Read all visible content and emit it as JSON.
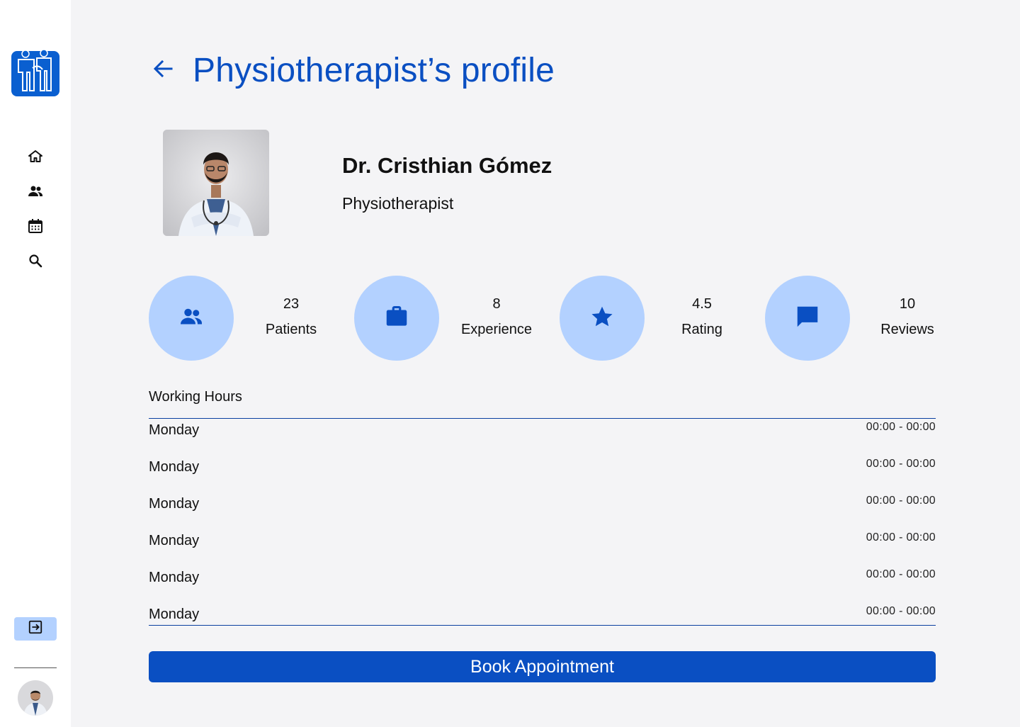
{
  "header": {
    "title": "Physiotherapist’s profile"
  },
  "sidebar": {
    "logo_icon": "family-care-logo",
    "nav": [
      {
        "icon": "home-icon"
      },
      {
        "icon": "people-icon"
      },
      {
        "icon": "calendar-icon"
      },
      {
        "icon": "search-icon"
      }
    ],
    "logout_icon": "logout-icon"
  },
  "doctor": {
    "name": "Dr. Cristhian Gómez",
    "role": "Physiotherapist"
  },
  "stats": [
    {
      "value": "23",
      "label": "Patients",
      "icon": "people-icon"
    },
    {
      "value": "8",
      "label": "Experience",
      "icon": "briefcase-icon"
    },
    {
      "value": "4.5",
      "label": "Rating",
      "icon": "star-icon"
    },
    {
      "value": "10",
      "label": "Reviews",
      "icon": "chat-icon"
    }
  ],
  "working_hours": {
    "title": "Working Hours",
    "rows": [
      {
        "day": "Monday",
        "time": "00:00 - 00:00"
      },
      {
        "day": "Monday",
        "time": "00:00 - 00:00"
      },
      {
        "day": "Monday",
        "time": "00:00 - 00:00"
      },
      {
        "day": "Monday",
        "time": "00:00 - 00:00"
      },
      {
        "day": "Monday",
        "time": "00:00 - 00:00"
      },
      {
        "day": "Monday",
        "time": "00:00 - 00:00"
      }
    ]
  },
  "actions": {
    "book_label": "Book Appointment"
  },
  "colors": {
    "primary": "#0a4fc2",
    "accent_light": "#b3d1ff",
    "background": "#f4f4f6"
  }
}
